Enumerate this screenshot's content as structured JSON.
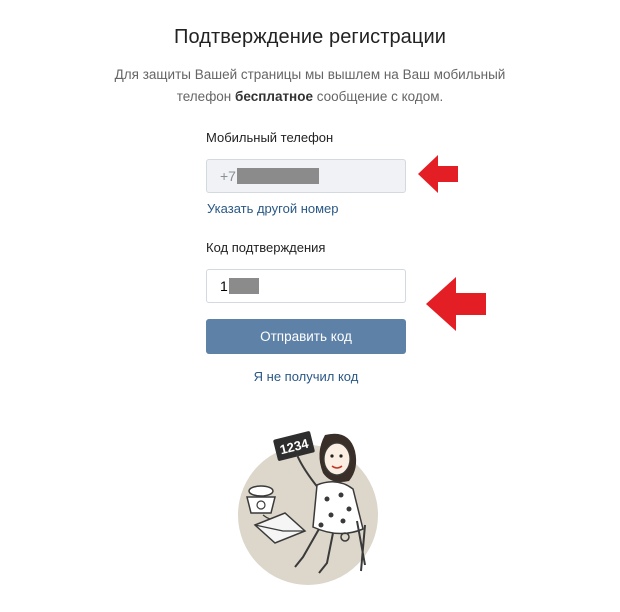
{
  "header": {
    "title": "Подтверждение регистрации",
    "desc_before": "Для защиты Вашей страницы мы вышлем на Ваш мобильный телефон ",
    "desc_bold": "бесплатное",
    "desc_after": " сообщение с кодом."
  },
  "phone": {
    "label": "Мобильный телефон",
    "prefix": "+7",
    "change_link": "Указать другой номер"
  },
  "code": {
    "label": "Код подтверждения",
    "value": "1"
  },
  "actions": {
    "send_button": "Отправить код",
    "not_received_link": "Я не получил код"
  },
  "illustration": {
    "sign_text": "1234"
  },
  "colors": {
    "accent": "#5e81a8",
    "link": "#2a5885",
    "arrow": "#e31e24"
  }
}
